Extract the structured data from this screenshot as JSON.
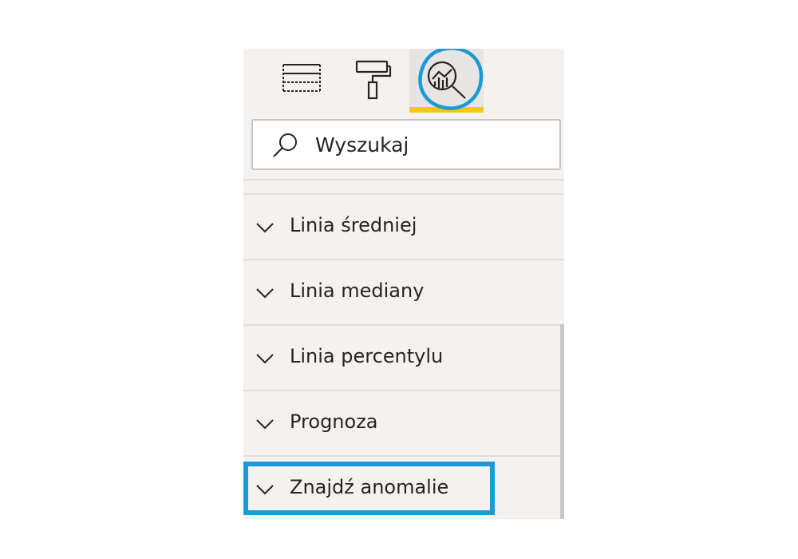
{
  "toolbar": {
    "tabs": [
      {
        "name": "fields",
        "icon": "fields-table-icon",
        "active": false
      },
      {
        "name": "format",
        "icon": "paint-roller-icon",
        "active": false
      },
      {
        "name": "analytics",
        "icon": "analytics-magnifier-icon",
        "active": true
      }
    ],
    "active_underline_color": "#f2c811"
  },
  "search": {
    "placeholder": "Wyszukaj",
    "value": ""
  },
  "sections": [
    {
      "label": "Linia średniej",
      "expanded": false
    },
    {
      "label": "Linia mediany",
      "expanded": false
    },
    {
      "label": "Linia percentylu",
      "expanded": false
    },
    {
      "label": "Prognoza",
      "expanded": false
    },
    {
      "label": "Znajdź anomalie",
      "expanded": false
    }
  ],
  "annotations": {
    "circle_color": "#1a9ad6",
    "highlight_box_color": "#1a9ad6"
  }
}
